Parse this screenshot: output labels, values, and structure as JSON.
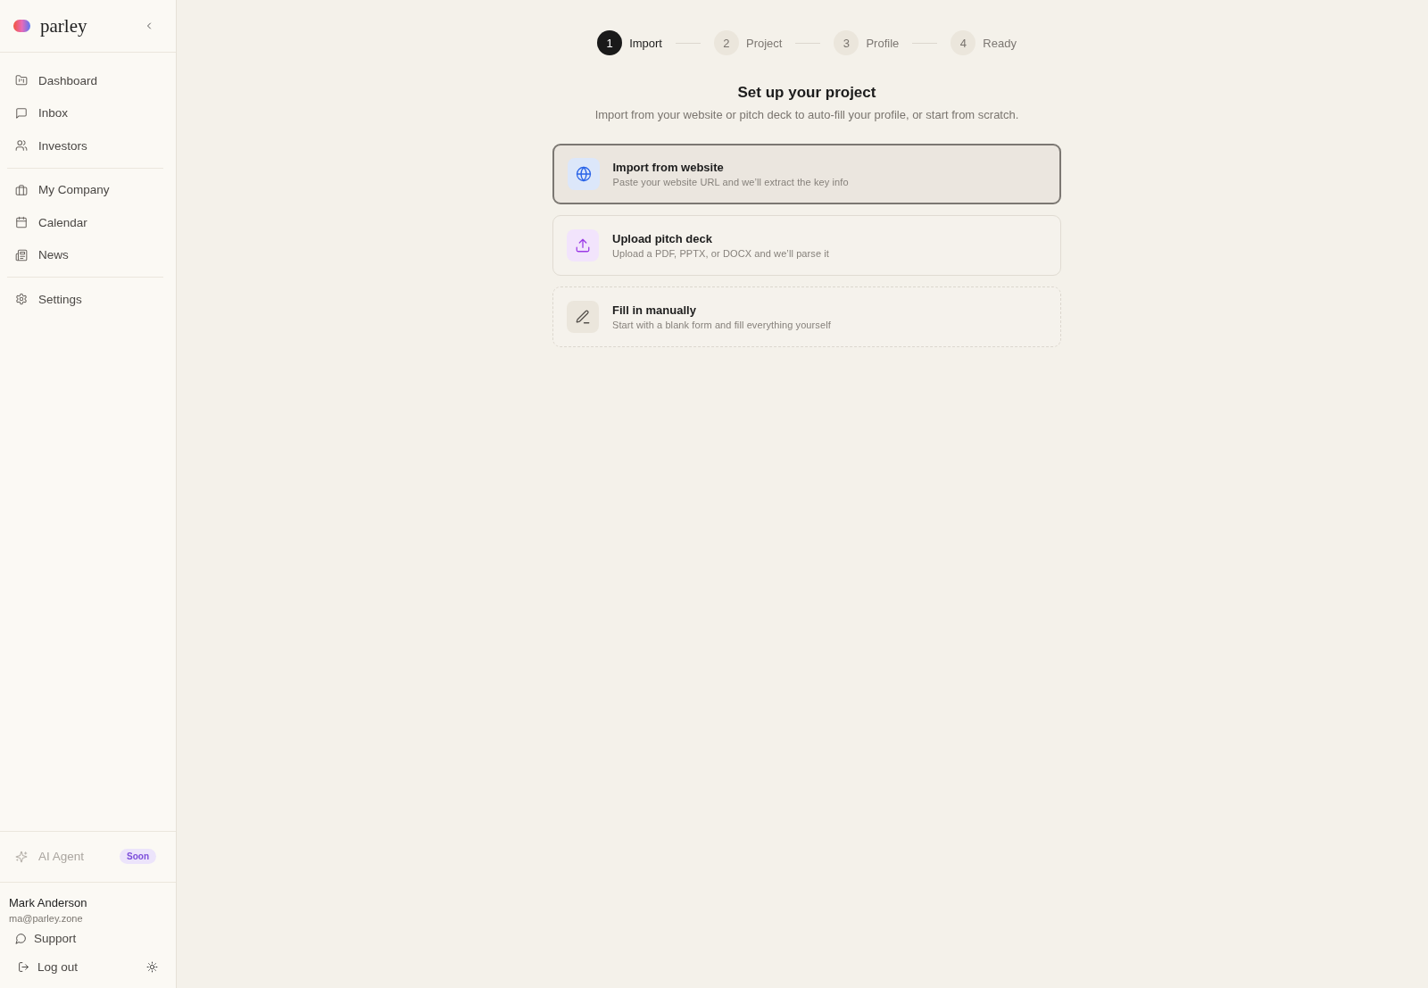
{
  "sidebar": {
    "brand": "parley",
    "nav_groups": [
      {
        "items": [
          {
            "label": "Dashboard",
            "selected": false
          },
          {
            "label": "Inbox",
            "selected": false
          },
          {
            "label": "Investors",
            "selected": false
          }
        ]
      },
      {
        "items": [
          {
            "label": "My Company",
            "selected": false
          },
          {
            "label": "Calendar",
            "selected": false
          },
          {
            "label": "News",
            "selected": false
          }
        ]
      },
      {
        "items": [
          {
            "label": "Settings",
            "selected": false
          }
        ]
      }
    ],
    "ai_agent": {
      "label": "AI Agent",
      "badge": "Soon",
      "disabled": true
    },
    "user": {
      "name": "Mark Anderson",
      "email": "ma@parley.zone"
    },
    "footer_links": [
      {
        "label": "Support"
      },
      {
        "label": "Log out"
      }
    ]
  },
  "stepper": [
    {
      "number": "1",
      "label": "Import",
      "selected": true
    },
    {
      "number": "2",
      "label": "Project",
      "selected": false
    },
    {
      "number": "3",
      "label": "Profile",
      "selected": false
    },
    {
      "number": "4",
      "label": "Ready",
      "selected": false
    }
  ],
  "heading": {
    "title": "Set up your project",
    "subtitle": "Import from your website or pitch deck to auto-fill your profile, or start from scratch."
  },
  "options": [
    {
      "kind": "website",
      "title": "Import from website",
      "description": "Paste your website URL and we’ll extract the key info",
      "selected": true
    },
    {
      "kind": "upload",
      "title": "Upload pitch deck",
      "description": "Upload a PDF, PPTX, or DOCX and we’ll parse it",
      "selected": false
    },
    {
      "kind": "manual",
      "title": "Fill in manually",
      "description": "Start with a blank form and fill everything yourself",
      "selected": false
    }
  ]
}
